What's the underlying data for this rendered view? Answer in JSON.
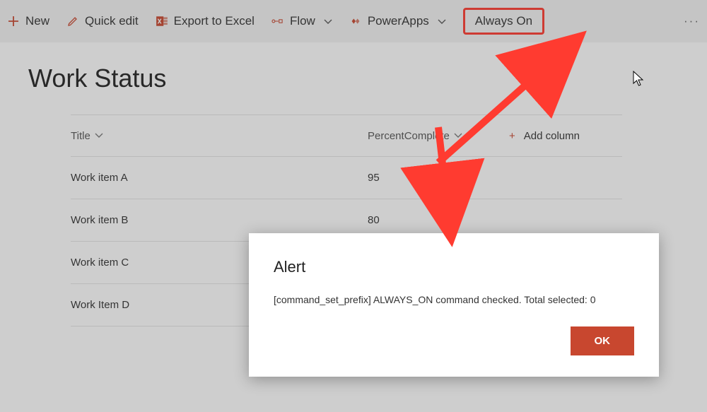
{
  "colors": {
    "accent": "#c8472f",
    "annotation": "#ff3b30"
  },
  "toolbar": {
    "new": "New",
    "quick_edit": "Quick edit",
    "export": "Export to Excel",
    "flow": "Flow",
    "powerapps": "PowerApps",
    "always_on": "Always On"
  },
  "page": {
    "title": "Work Status"
  },
  "list": {
    "columns": {
      "title": "Title",
      "percent": "PercentComplete",
      "add": "Add column"
    },
    "rows": [
      {
        "title": "Work item A",
        "percent": "95"
      },
      {
        "title": "Work item B",
        "percent": "80"
      },
      {
        "title": "Work item C",
        "percent": ""
      },
      {
        "title": "Work Item D",
        "percent": ""
      }
    ]
  },
  "dialog": {
    "title": "Alert",
    "message": "[command_set_prefix] ALWAYS_ON command checked. Total selected: 0",
    "ok": "OK"
  }
}
